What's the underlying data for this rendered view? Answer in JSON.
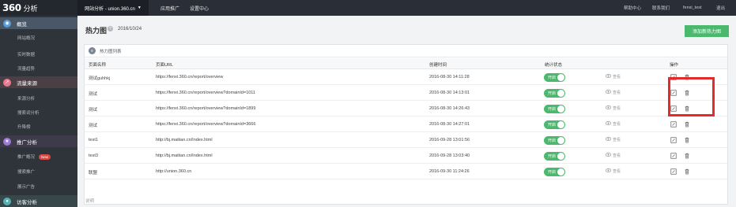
{
  "brand": {
    "mark": "360",
    "name": "分析"
  },
  "header": {
    "site_selector": "网站分析 - union.360.cn",
    "nav": [
      "应用推广",
      "设置中心"
    ],
    "right": [
      "帮助中心",
      "联系我们",
      "fenxi_test",
      "退出"
    ]
  },
  "sidebar": {
    "sections": [
      {
        "label": "概览",
        "items": [
          "网站概况",
          "实时数据",
          "流量趋势"
        ]
      },
      {
        "label": "流量来源",
        "items": [
          "来源分析",
          "搜索词分析",
          "升降榜"
        ]
      },
      {
        "label": "推广分析",
        "items": [
          "推广概况",
          "搜索推广",
          "展示广告"
        ],
        "badge": "New"
      },
      {
        "label": "访客分析",
        "items": []
      }
    ]
  },
  "main": {
    "title": "热力图",
    "date": "2016/10/24",
    "add_button": "添加新热力图",
    "panel_title": "热力图列表",
    "columns": [
      "页面名称",
      "页面URL",
      "创建时间",
      "统计状态",
      "",
      "操作"
    ],
    "toggle_label": "开启",
    "view_label": "查看",
    "rows": [
      {
        "name": "测试guhhkj",
        "url": "https://fenxi.360.cn/report/overview",
        "time": "2016-08-30 14:11:28"
      },
      {
        "name": "测试",
        "url": "https://fenxi.360.cn/report/overview?domainId=1011",
        "time": "2016-08-30 14:13:01"
      },
      {
        "name": "测试",
        "url": "https://fenxi.360.cn/report/overview?domainId=1899",
        "time": "2016-08-30 14:26:43"
      },
      {
        "name": "测试",
        "url": "https://fenxi.360.cn/report/overview?domainId=3666",
        "time": "2016-08-30 14:27:01"
      },
      {
        "name": "test1",
        "url": "http://bj.maitian.cn/Index.html",
        "time": "2016-09-28 13:01:56"
      },
      {
        "name": "test3",
        "url": "http://bj.maitian.cn/Index.html",
        "time": "2016-09-28 13:03:40"
      },
      {
        "name": "联盟",
        "url": "http://union.360.cn",
        "time": "2016-09-30 11:24:26"
      }
    ],
    "note": "说明"
  },
  "colors": {
    "accent": "#4bb86e",
    "highlight": "#e32b2b"
  }
}
